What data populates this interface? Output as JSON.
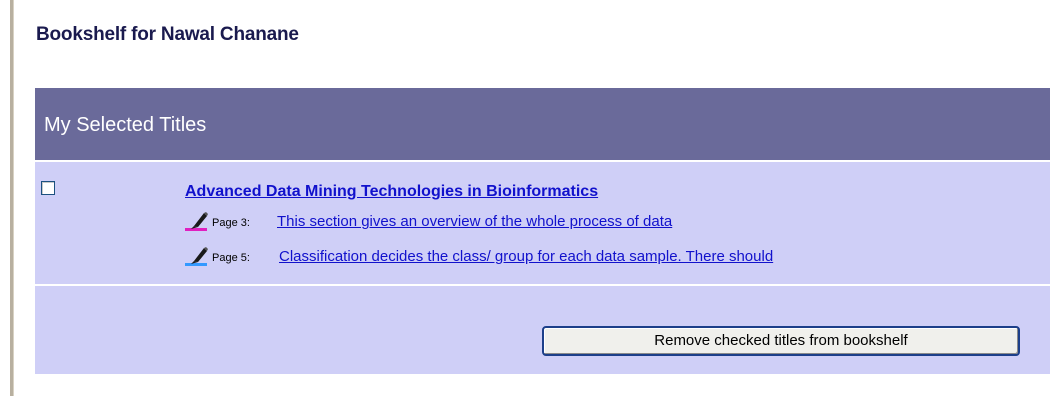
{
  "page": {
    "title": "Bookshelf for Nawal Chanane"
  },
  "panel": {
    "header": "My Selected Titles"
  },
  "book": {
    "checked": false,
    "title": "Advanced Data Mining Technologies in Bioinformatics",
    "notes": [
      {
        "highlight_color": "#e020c0",
        "icon": "pink-highlighter-pen-icon",
        "page_label": "Page 3:",
        "text": "This section gives an overview of the whole process of data"
      },
      {
        "highlight_color": "#3399ff",
        "icon": "blue-highlighter-pen-icon",
        "page_label": "Page 5:",
        "text": "Classification decides the class/ group for each data sample. There should"
      }
    ]
  },
  "actions": {
    "remove_label": "Remove checked titles from bookshelf"
  },
  "colors": {
    "header_bg": "#6a6a9a",
    "panel_bg": "#cfcff7",
    "link": "#1111cc",
    "title_text": "#1a1a4e"
  }
}
